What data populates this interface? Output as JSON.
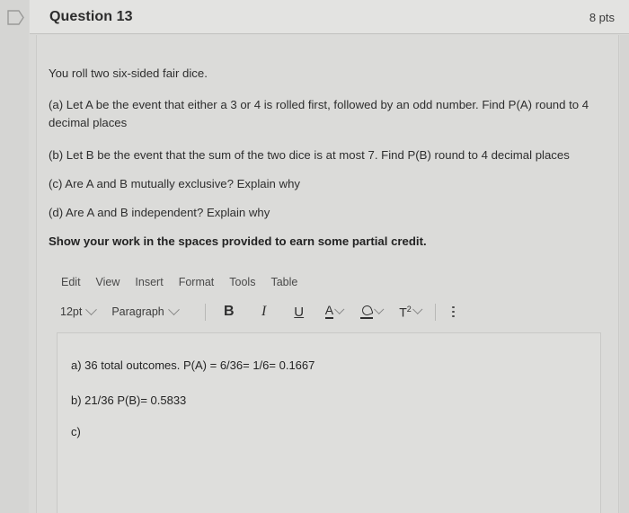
{
  "header": {
    "flag_icon": "bookmark-flag-icon",
    "title": "Question 13",
    "points": "8 pts"
  },
  "question": {
    "intro": "You roll two six-sided fair dice.",
    "part_a": "(a) Let A be the event that either a 3 or 4 is rolled first, followed by an odd number. Find P(A) round to 4 decimal places",
    "part_b": "(b) Let B be the event that the sum of the two dice is at most 7. Find P(B) round to 4 decimal places",
    "part_c": "(c) Are A and B mutually exclusive? Explain why",
    "part_d": "(d) Are A and B independent? Explain why",
    "note": "Show your work in the spaces provided to earn some partial credit."
  },
  "editor": {
    "menus": [
      {
        "label": "Edit"
      },
      {
        "label": "View"
      },
      {
        "label": "Insert"
      },
      {
        "label": "Format"
      },
      {
        "label": "Tools"
      },
      {
        "label": "Table"
      }
    ],
    "toolbar": {
      "font_size": "12pt",
      "block_format": "Paragraph",
      "bold": "B",
      "italic": "I",
      "underline": "U",
      "text_color": "A",
      "highlight": "highlighter-pen-icon",
      "superscript_t": "T",
      "superscript_exp": "2",
      "more_options": "more-options-icon"
    }
  },
  "answer": {
    "lines": [
      "a) 36 total outcomes. P(A) = 6/36= 1/6= 0.1667",
      "b) 21/36 P(B)= 0.5833",
      "c)"
    ]
  },
  "colors": {
    "page_bg": "#d9d9d7",
    "header_bg": "#e3e3e1",
    "border": "#c9c9c7",
    "text": "#2e2e2e"
  }
}
